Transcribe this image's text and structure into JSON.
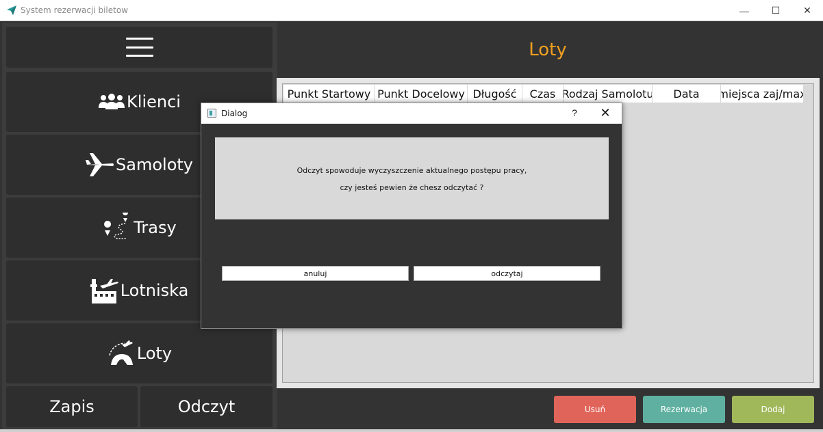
{
  "window": {
    "title": "System rezerwacji biletow",
    "minimize_glyph": "—",
    "maximize_glyph": "☐",
    "close_glyph": "✕"
  },
  "sidebar": {
    "items": [
      {
        "label": "Klienci",
        "icon": "users-icon"
      },
      {
        "label": "Samoloty",
        "icon": "airplane-icon"
      },
      {
        "label": "Trasy",
        "icon": "route-icon"
      },
      {
        "label": "Lotniska",
        "icon": "airport-icon"
      },
      {
        "label": "Loty",
        "icon": "flight-icon"
      }
    ],
    "save_label": "Zapis",
    "load_label": "Odczyt"
  },
  "main": {
    "title": "Loty",
    "title_color": "#f0a020",
    "table_headers": [
      "Punkt Startowy",
      "Punkt Docelowy",
      "Długość",
      "Czas",
      "Rodzaj Samolotu",
      "Data",
      "miejsca zaj/max"
    ]
  },
  "actions": {
    "delete_label": "Usuń",
    "reserve_label": "Rezerwacja",
    "add_label": "Dodaj",
    "delete_color": "#e0645a",
    "reserve_color": "#5fb0a0",
    "add_color": "#a0b85a"
  },
  "dialog": {
    "title": "Dialog",
    "help_glyph": "?",
    "close_glyph": "✕",
    "message_line1": "Odczyt spowoduje wyczyszczenie aktualnego postępu pracy,",
    "message_line2": "czy jesteś pewien że chesz odczytać ?",
    "cancel_label": "anuluj",
    "confirm_label": "odczytaj"
  }
}
